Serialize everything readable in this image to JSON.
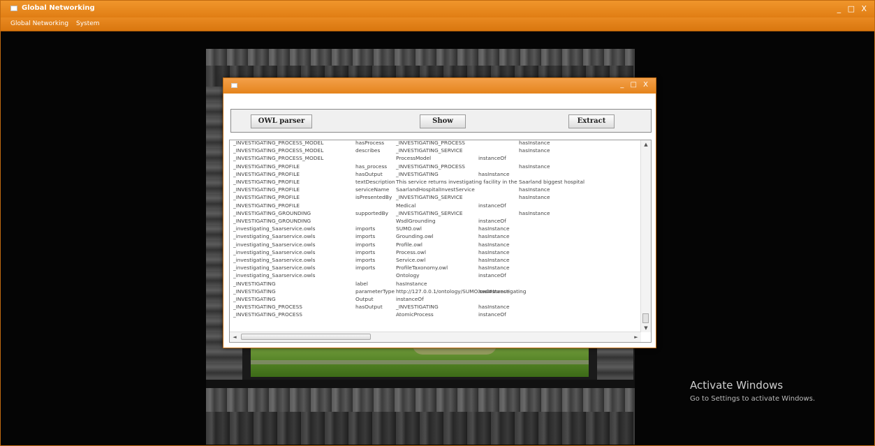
{
  "main_window": {
    "title": "Global Networking",
    "controls": "_ □ X",
    "menu": [
      "Global Networking",
      "System"
    ]
  },
  "dialog": {
    "controls": "_ □ X",
    "buttons": {
      "owl_parser": "OWL parser",
      "show": "Show",
      "extract": "Extract"
    },
    "rows": [
      [
        "_INVESTIGATING_PROCESS_MODEL",
        "hasProcess",
        "_INVESTIGATING_PROCESS",
        "",
        "hasInstance"
      ],
      [
        "_INVESTIGATING_PROCESS_MODEL",
        "describes",
        "_INVESTIGATING_SERVICE",
        "",
        "hasInstance"
      ],
      [
        "_INVESTIGATING_PROCESS_MODEL",
        "",
        "ProcessModel",
        "instanceOf",
        ""
      ],
      [
        "_INVESTIGATING_PROFILE",
        "has_process",
        "_INVESTIGATING_PROCESS",
        "",
        "hasInstance"
      ],
      [
        "_INVESTIGATING_PROFILE",
        "hasOutput",
        "_INVESTIGATING",
        "hasInstance",
        ""
      ],
      [
        "_INVESTIGATING_PROFILE",
        "textDescription",
        "This service returns investigating facility in the Saarland biggest hospital",
        "",
        ""
      ],
      [
        "_INVESTIGATING_PROFILE",
        "serviceName",
        "SaarlandHospitalInvestService",
        "",
        "hasInstance"
      ],
      [
        "_INVESTIGATING_PROFILE",
        "isPresentedBy",
        "_INVESTIGATING_SERVICE",
        "",
        "hasInstance"
      ],
      [
        "_INVESTIGATING_PROFILE",
        "",
        "Medical",
        "instanceOf",
        ""
      ],
      [
        "_INVESTIGATING_GROUNDING",
        "supportedBy",
        "_INVESTIGATING_SERVICE",
        "",
        "hasInstance"
      ],
      [
        "_INVESTIGATING_GROUNDING",
        "",
        "WsdlGrounding",
        "instanceOf",
        ""
      ],
      [
        "_investigating_Saarservice.owls",
        "imports",
        "SUMO.owl",
        "hasInstance",
        ""
      ],
      [
        "_investigating_Saarservice.owls",
        "imports",
        "Grounding.owl",
        "hasInstance",
        ""
      ],
      [
        "_investigating_Saarservice.owls",
        "imports",
        "Profile.owl",
        "hasInstance",
        ""
      ],
      [
        "_investigating_Saarservice.owls",
        "imports",
        "Process.owl",
        "hasInstance",
        ""
      ],
      [
        "_investigating_Saarservice.owls",
        "imports",
        "Service.owl",
        "hasInstance",
        ""
      ],
      [
        "_investigating_Saarservice.owls",
        "imports",
        "ProfileTaxonomy.owl",
        "hasInstance",
        ""
      ],
      [
        "_investigating_Saarservice.owls",
        "",
        "Ontology",
        "instanceOf",
        ""
      ],
      [
        "_INVESTIGATING",
        "label",
        "hasInstance",
        "",
        ""
      ],
      [
        "_INVESTIGATING",
        "parameterType",
        "http://127.0.0.1/ontology/SUMO.owl#Investigating",
        "hasInstance",
        ""
      ],
      [
        "_INVESTIGATING",
        "Output",
        "instanceOf",
        "",
        ""
      ],
      [
        "_INVESTIGATING_PROCESS",
        "hasOutput",
        "_INVESTIGATING",
        "hasInstance",
        ""
      ],
      [
        "_INVESTIGATING_PROCESS",
        "",
        "AtomicProcess",
        "instanceOf",
        ""
      ]
    ]
  },
  "watermark": {
    "title": "Activate Windows",
    "subtitle": "Go to Settings to activate Windows."
  }
}
